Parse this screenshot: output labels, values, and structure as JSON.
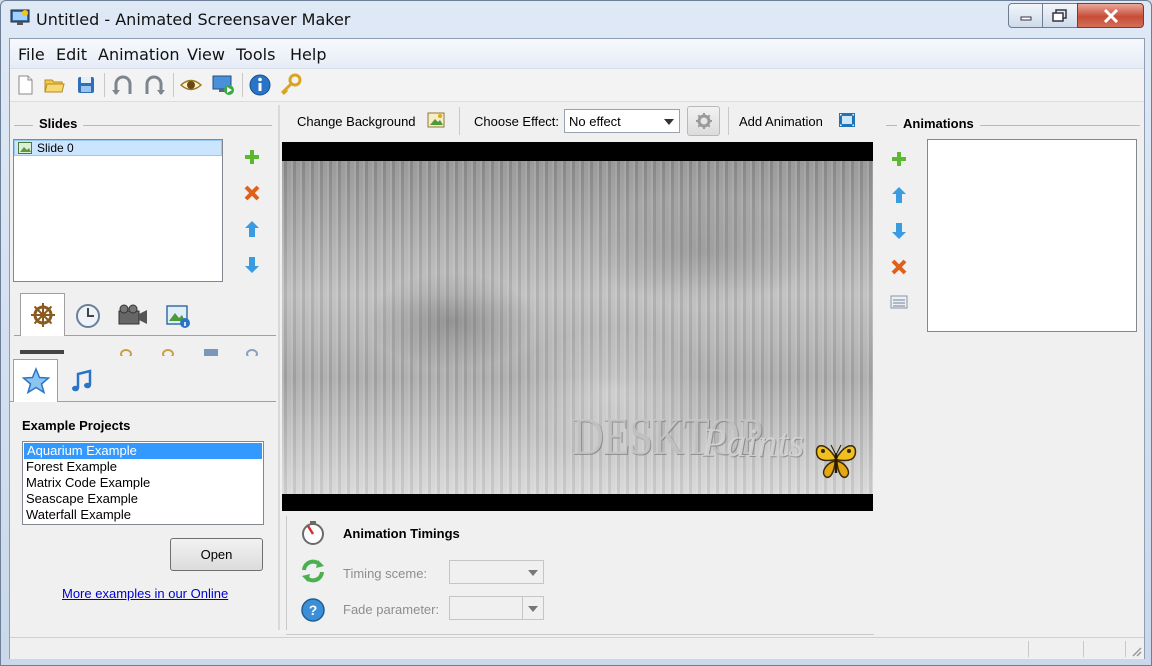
{
  "window": {
    "title": "Untitled - Animated Screensaver Maker"
  },
  "menu": [
    "File",
    "Edit",
    "Animation",
    "View",
    "Tools",
    "Help"
  ],
  "toolbar": {
    "icons": [
      "new-file-icon",
      "open-folder-icon",
      "save-icon",
      "undo-icon",
      "redo-icon",
      "preview-eye-icon",
      "run-screensaver-icon",
      "info-icon",
      "key-icon"
    ]
  },
  "slides": {
    "header": "Slides",
    "items": [
      "Slide 0"
    ]
  },
  "example_projects": {
    "header": "Example Projects",
    "items": [
      "Aquarium Example",
      "Forest Example",
      "Matrix Code Example",
      "Seascape Example",
      "Waterfall Example"
    ],
    "selected_index": 0,
    "open_label": "Open",
    "more_link": "More examples in our Online"
  },
  "editor_toolbar": {
    "change_background": "Change Background",
    "choose_effect_label": "Choose Effect:",
    "effect_value": "No effect",
    "add_animation": "Add Animation"
  },
  "preview": {
    "watermark_1": "DESKTOP",
    "watermark_2": "Paints"
  },
  "timings": {
    "header": "Animation Timings",
    "timing_scheme_label": "Timing sceme:",
    "fade_parameter_label": "Fade parameter:"
  },
  "animations": {
    "header": "Animations"
  },
  "colors": {
    "selection": "#3399ff",
    "add_green": "#5cb82e",
    "delete_orange": "#e0601a",
    "arrow_blue": "#3b9be0",
    "link": "#0000cc"
  }
}
